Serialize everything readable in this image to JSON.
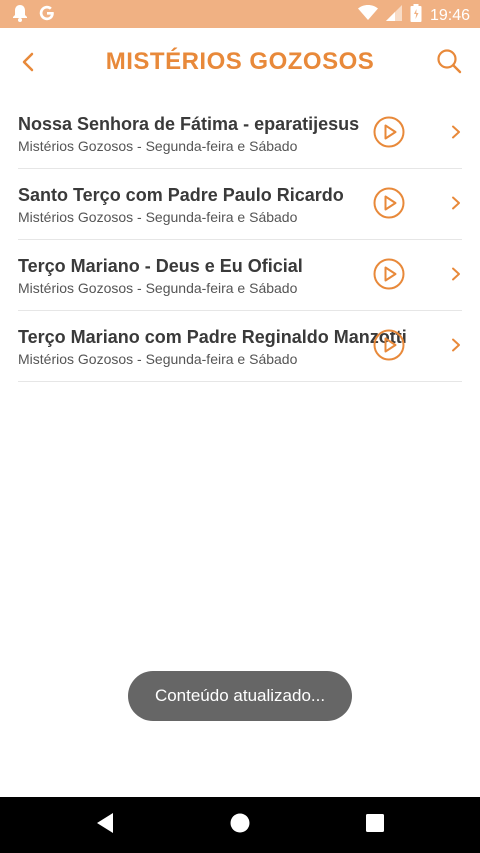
{
  "colors": {
    "accent": "#e8893a",
    "status_bar": "#f0b183",
    "toast_bg": "#666666"
  },
  "status_bar": {
    "time": "19:46",
    "icons": [
      "notification-bell-icon",
      "google-icon",
      "wifi-icon",
      "signal-icon",
      "battery-icon"
    ]
  },
  "header": {
    "title": "MISTÉRIOS GOZOSOS",
    "back_icon": "chevron-left-icon",
    "search_icon": "search-icon"
  },
  "list": {
    "items": [
      {
        "title": "Nossa Senhora de Fátima - eparatijesus",
        "subtitle": "Mistérios Gozosos - Segunda-feira e Sábado"
      },
      {
        "title": "Santo Terço com Padre Paulo Ricardo",
        "subtitle": "Mistérios Gozosos - Segunda-feira e Sábado"
      },
      {
        "title": "Terço Mariano - Deus e Eu Oficial",
        "subtitle": "Mistérios Gozosos - Segunda-feira e Sábado"
      },
      {
        "title": "Terço Mariano com Padre Reginaldo Manzotti",
        "subtitle": "Mistérios Gozosos - Segunda-feira e Sábado"
      }
    ]
  },
  "toast": {
    "text": "Conteúdo atualizado..."
  },
  "nav_bar": {
    "icons": [
      "back-triangle-icon",
      "home-circle-icon",
      "recents-square-icon"
    ]
  }
}
